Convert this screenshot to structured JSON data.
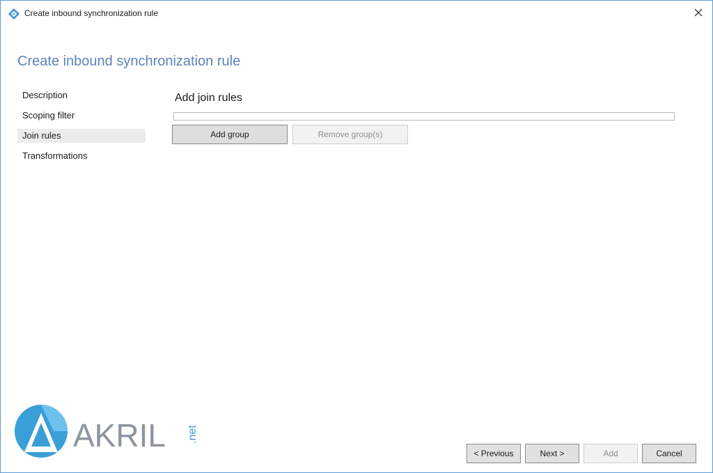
{
  "window": {
    "title": "Create inbound synchronization rule",
    "close_glyph": "✕"
  },
  "page": {
    "heading": "Create inbound synchronization rule",
    "section_title": "Add join rules"
  },
  "nav": {
    "items": [
      {
        "label": "Description"
      },
      {
        "label": "Scoping filter"
      },
      {
        "label": "Join rules",
        "selected": true
      },
      {
        "label": "Transformations"
      }
    ]
  },
  "join_rules": {
    "add_group_label": "Add group",
    "remove_group_label": "Remove group(s)"
  },
  "footer": {
    "previous_label": "< Previous",
    "next_label": "Next >",
    "add_label": "Add",
    "cancel_label": "Cancel"
  },
  "watermark": {
    "brand": "AKRIL",
    "suffix": ".net"
  },
  "colors": {
    "accent": "#5b83b5",
    "border_blue": "#5b9bd5",
    "logo_blue": "#3a9fd8",
    "logo_gray": "#8c95a0"
  },
  "icons": {
    "app": "sync-diamond-icon",
    "close": "close-icon",
    "logo": "akril-logo-icon"
  }
}
